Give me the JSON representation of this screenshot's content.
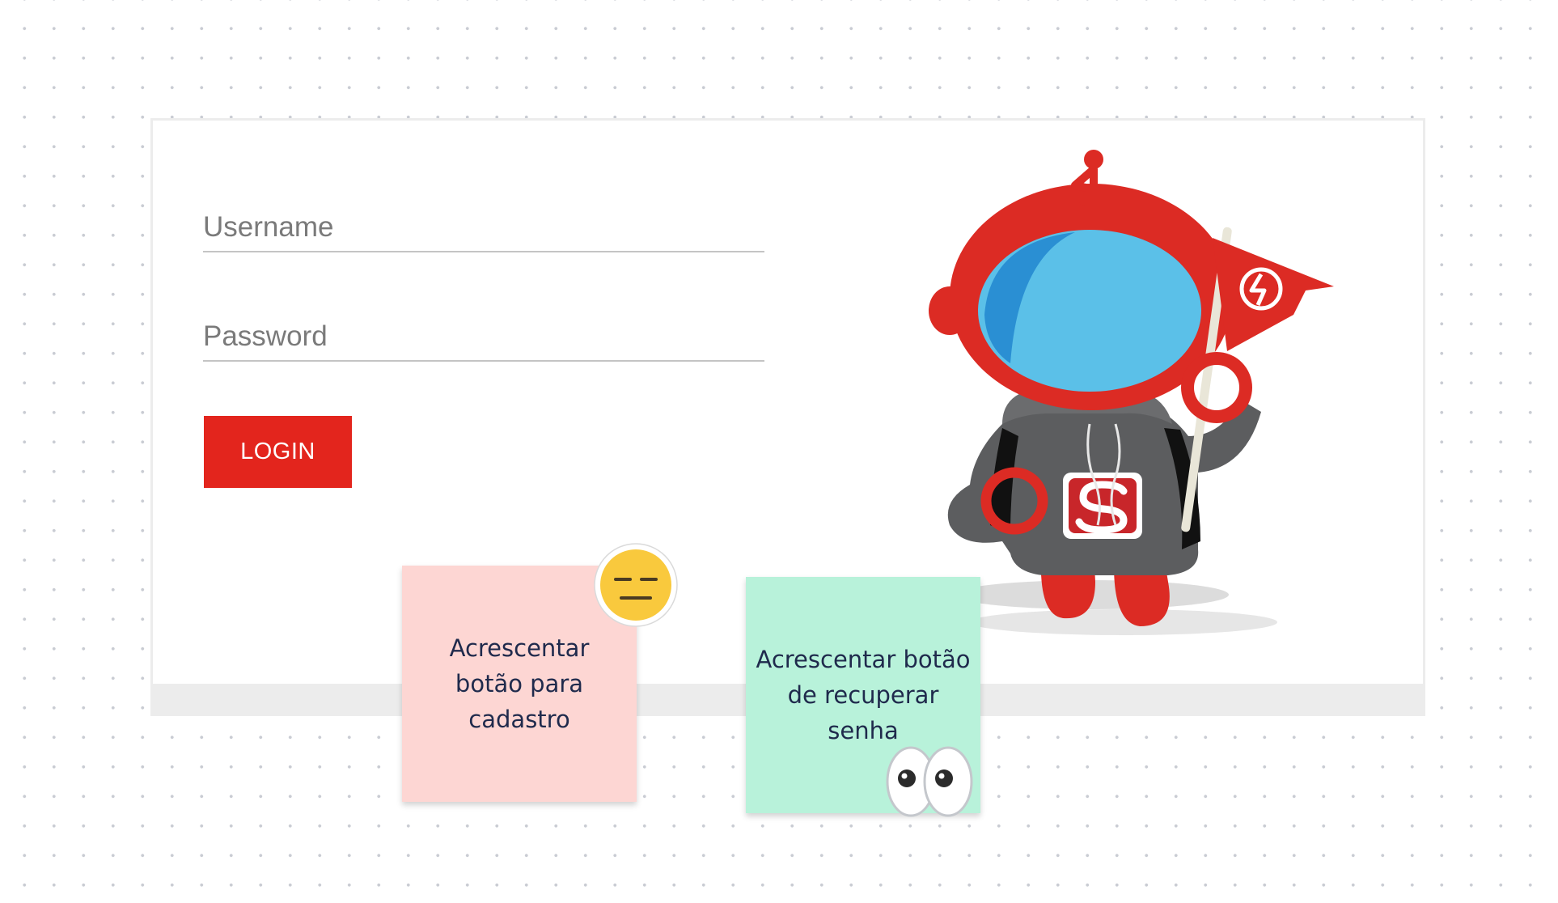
{
  "login_form": {
    "username_placeholder": "Username",
    "password_placeholder": "Password",
    "login_label": "LOGIN",
    "accent_color": "#e3251d"
  },
  "mascot": {
    "icon": "robot-mascot-with-flag"
  },
  "stickies": [
    {
      "text": "Acrescentar botão para cadastro",
      "color": "#fdd6d3",
      "reaction": "expressionless-face-icon"
    },
    {
      "text": "Acrescentar botão de recuperar senha",
      "color": "#b8f2da",
      "reaction": "eyes-icon"
    }
  ]
}
